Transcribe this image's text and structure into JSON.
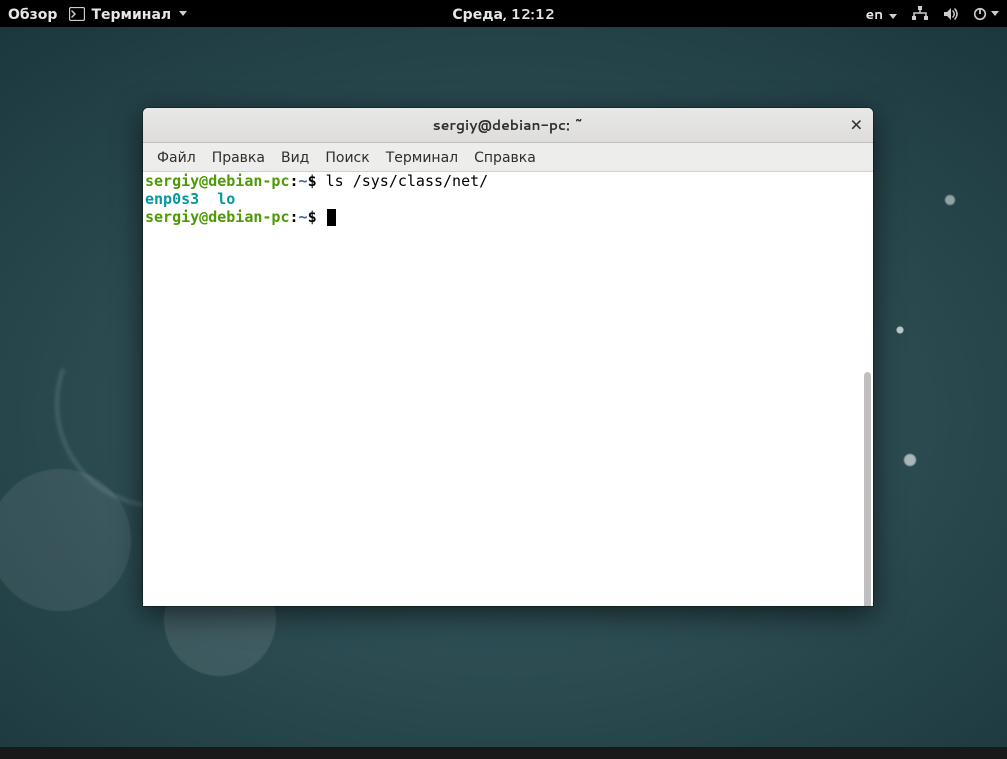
{
  "topbar": {
    "activities": "Обзор",
    "app_name": "Терминал",
    "clock": "Среда, 12:12",
    "lang": "en"
  },
  "window": {
    "title": "sergiy@debian-pc: ~"
  },
  "menubar": {
    "file": "Файл",
    "edit": "Правка",
    "view": "Вид",
    "search": "Поиск",
    "terminal": "Терминал",
    "help": "Справка"
  },
  "terminal": {
    "prompt1": {
      "userhost": "sergiy@debian-pc",
      "sep": ":",
      "path": "~",
      "dollar": "$",
      "command": "ls /sys/class/net/"
    },
    "output": "enp0s3  lo",
    "prompt2": {
      "userhost": "sergiy@debian-pc",
      "sep": ":",
      "path": "~",
      "dollar": "$"
    }
  }
}
